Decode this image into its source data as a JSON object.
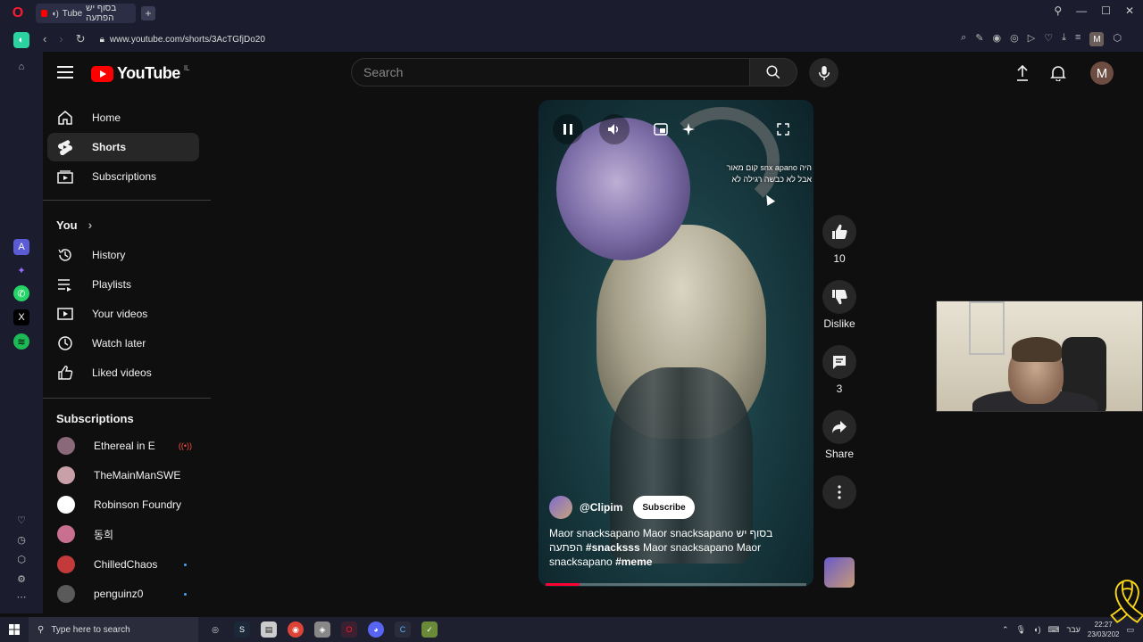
{
  "browser": {
    "tab_title": "בסוף יש הפתעה",
    "tab_prefix": "Tube",
    "url": "www.youtube.com/shorts/3AcTGfjDo20"
  },
  "header": {
    "logo_text": "YouTube",
    "country_code": "IL",
    "search_placeholder": "Search",
    "avatar_letter": "M"
  },
  "guide": {
    "main": [
      {
        "label": "Home",
        "icon": "home-icon"
      },
      {
        "label": "Shorts",
        "icon": "shorts-icon"
      },
      {
        "label": "Subscriptions",
        "icon": "subscriptions-icon"
      }
    ],
    "you_heading": "You",
    "you_items": [
      {
        "label": "History",
        "icon": "history-icon"
      },
      {
        "label": "Playlists",
        "icon": "playlists-icon"
      },
      {
        "label": "Your videos",
        "icon": "your-videos-icon"
      },
      {
        "label": "Watch later",
        "icon": "clock-icon"
      },
      {
        "label": "Liked videos",
        "icon": "thumb-up-icon"
      }
    ],
    "subscriptions_heading": "Subscriptions",
    "subscriptions": [
      {
        "label": "Ethereal in E",
        "status": "live",
        "color": "#8a6a7a"
      },
      {
        "label": "TheMainManSWE",
        "status": "",
        "color": "#c9a0a8"
      },
      {
        "label": "Robinson Foundry",
        "status": "",
        "color": "#ffffff"
      },
      {
        "label": "동희",
        "status": "",
        "color": "#c97090"
      },
      {
        "label": "ChilledChaos",
        "status": "new",
        "color": "#c33a3a"
      },
      {
        "label": "penguinz0",
        "status": "new",
        "color": "#5a5a5a"
      }
    ]
  },
  "short": {
    "overlay_line1": "היה snx apano קום מאור",
    "overlay_line2": "אבל לא כבשה רגילה לא",
    "channel": "@Clipim",
    "subscribe_label": "Subscribe",
    "title_part1": "Maor snacksapano Maor snacksapano בסוף יש הפתעה",
    "hashtag1": "#snacksss",
    "title_part2": "Maor snacksapano Maor snacksapano",
    "hashtag2": "#meme",
    "progress": 0.13
  },
  "actions": {
    "like_count": "10",
    "dislike_label": "Dislike",
    "comment_count": "3",
    "share_label": "Share"
  },
  "taskbar": {
    "search_placeholder": "Type here to search",
    "lang": "עבר",
    "time": "22:27",
    "date": "23/03/202"
  },
  "colors": {
    "accent_red": "#ff0000",
    "background": "#0f0f0f",
    "ribbon": "#f7d417"
  }
}
